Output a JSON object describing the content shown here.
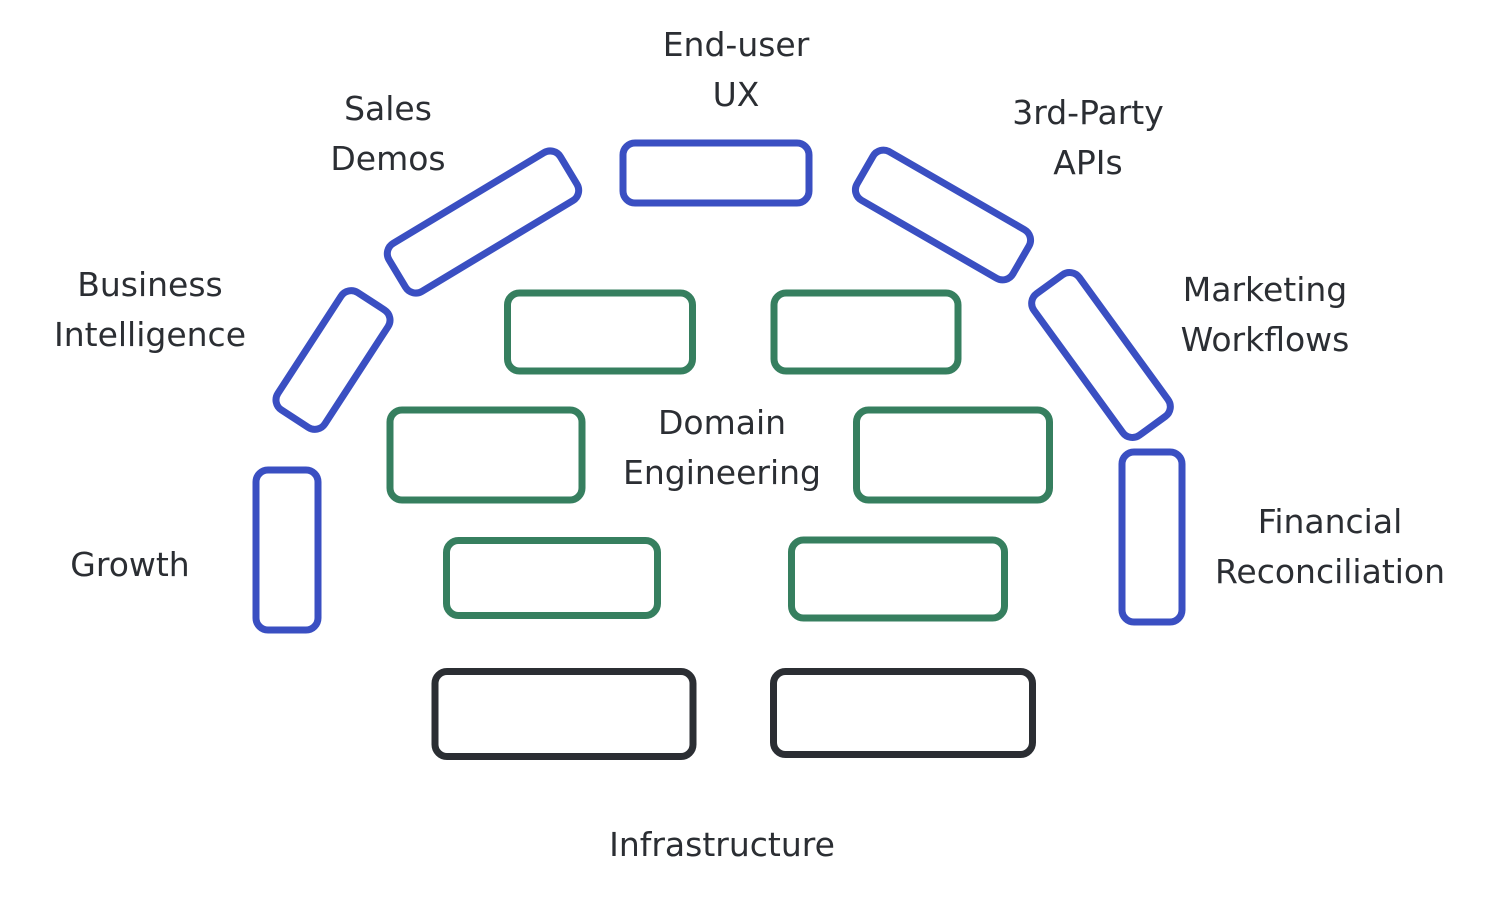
{
  "colors": {
    "customer_facing": "#3a4fc2",
    "domain": "#367f5f",
    "infrastructure": "#2b2e33"
  },
  "labels": {
    "end_user_ux": [
      "End-user",
      "UX"
    ],
    "sales_demos": [
      "Sales",
      "Demos"
    ],
    "third_party_apis": [
      "3rd-Party",
      "APIs"
    ],
    "business_intelligence": [
      "Business",
      "Intelligence"
    ],
    "marketing_workflows": [
      "Marketing",
      "Workflows"
    ],
    "growth": [
      "Growth"
    ],
    "financial_reconciliation": [
      "Financial",
      "Reconciliation"
    ],
    "domain_engineering": [
      "Domain",
      "Engineering"
    ],
    "infrastructure": [
      "Infrastructure"
    ]
  }
}
